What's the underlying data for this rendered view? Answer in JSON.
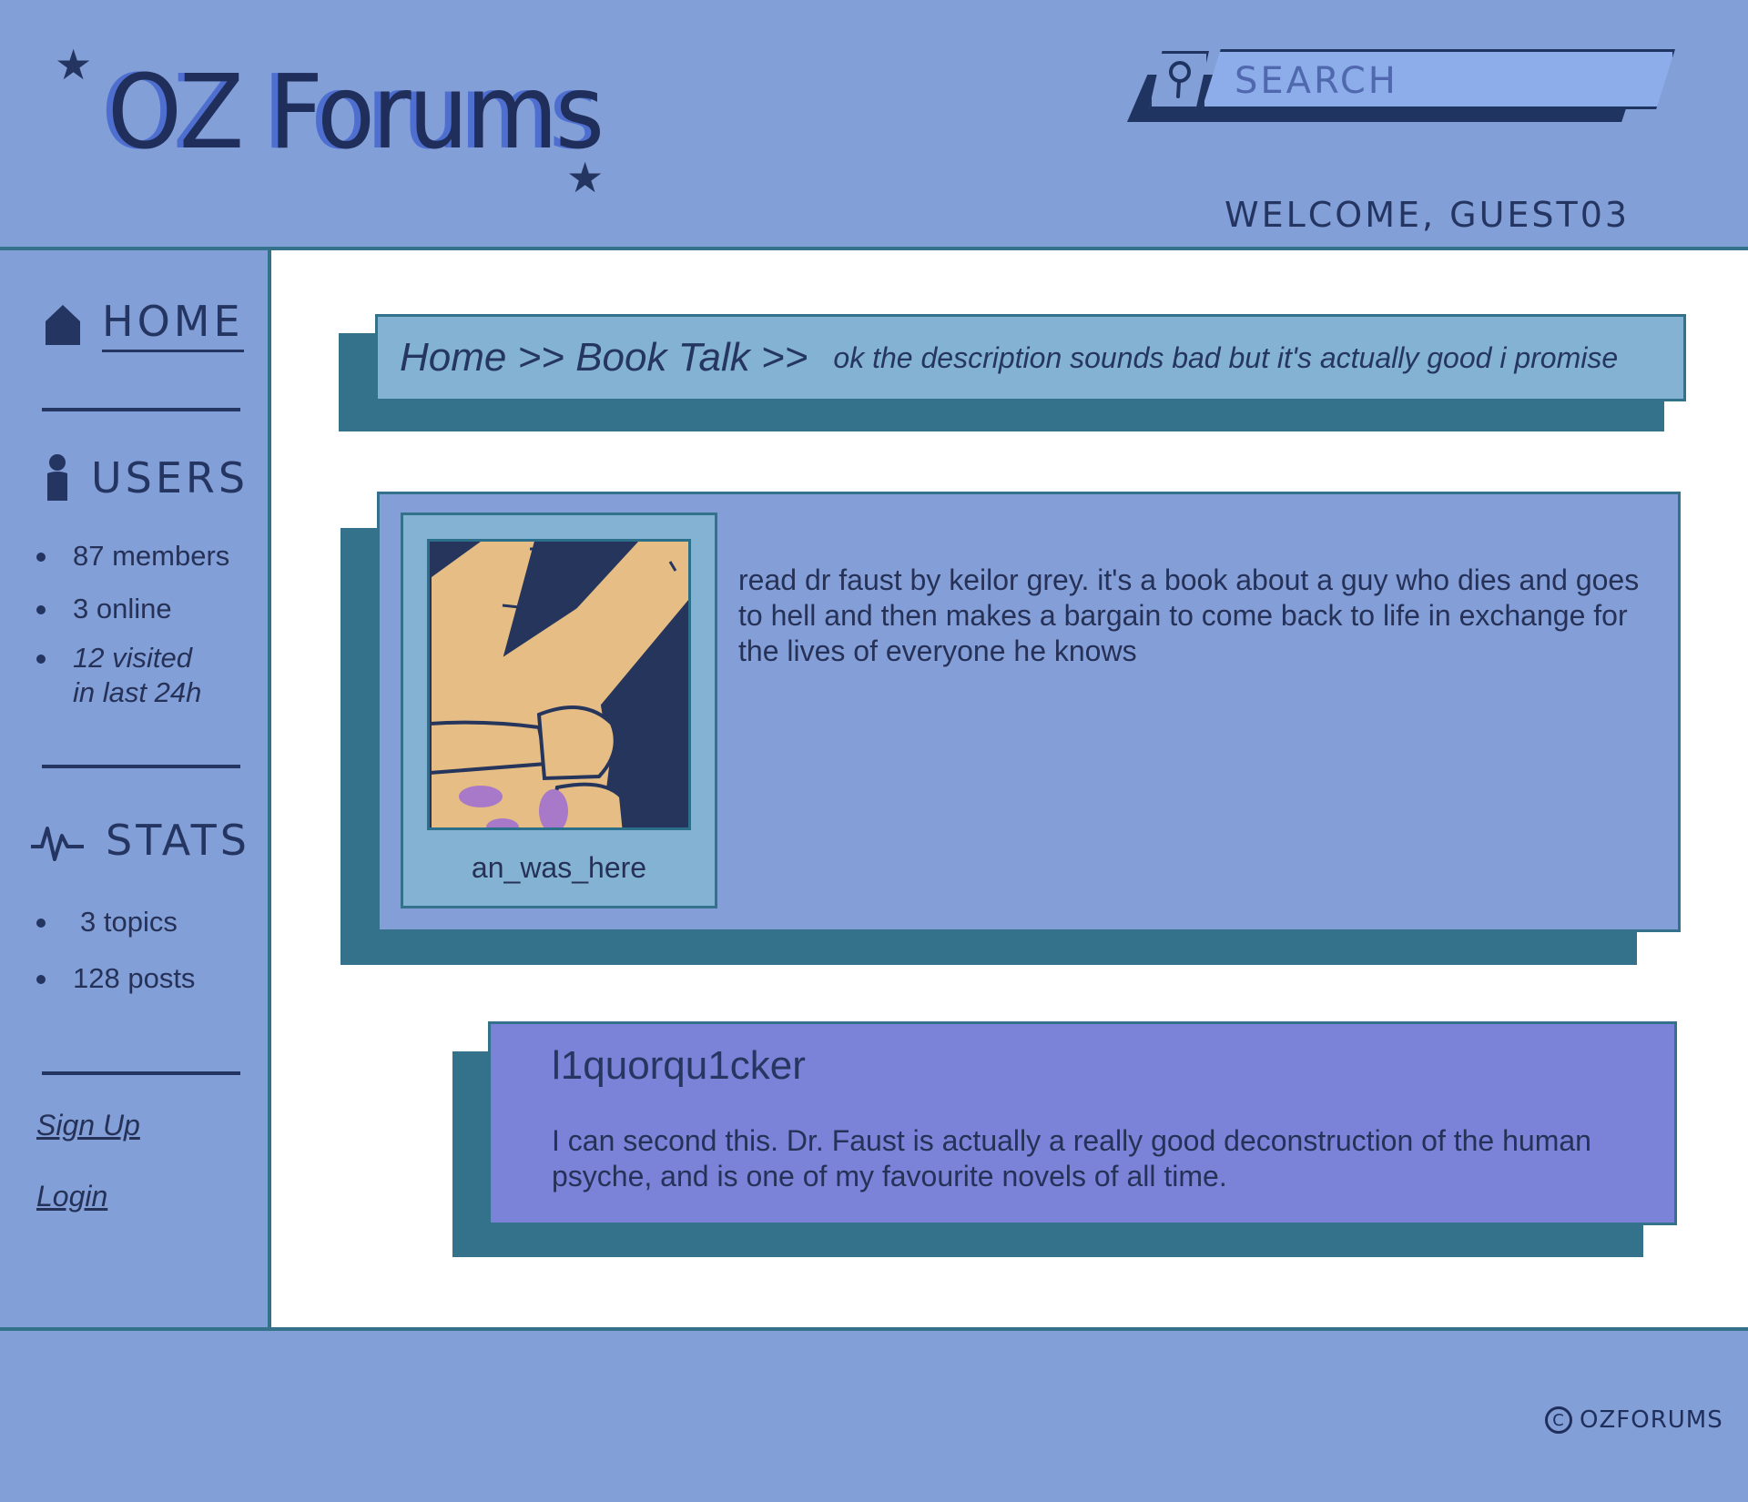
{
  "header": {
    "logo": "OZ Forums",
    "search_placeholder": "SEARCH",
    "welcome": "WELCOME, GUEST03"
  },
  "sidebar": {
    "home_label": "HOME",
    "users_label": "USERS",
    "users_stats": [
      "87 members",
      "3 online",
      "12 visited",
      "in last 24h"
    ],
    "stats_label": "STATS",
    "stats_items": [
      "3 topics",
      "128 posts"
    ],
    "sign_up": "Sign Up",
    "login": "Login"
  },
  "breadcrumb": {
    "path": "Home >> Book Talk >>",
    "thread_title": "ok the description sounds bad but it's actually good i promise"
  },
  "posts": [
    {
      "author": "an_was_here",
      "body": "read dr faust by keilor grey. it's a book about a guy who dies and goes to hell and then makes a bargain to come back to life in exchange for the lives of everyone he knows"
    },
    {
      "author": "l1quorqu1cker",
      "body": "I can second this. Dr. Faust is actually a really good deconstruction of the human psyche, and is one of my favourite novels of all time."
    }
  ],
  "footer": {
    "copyright": "OZFORUMS"
  },
  "colors": {
    "page_bg": "#839fd7",
    "rule": "#34718b",
    "ink": "#243561",
    "breadcrumb_bg": "#84b2d3",
    "post2_bg": "#7b83d8",
    "search_bg": "#8cacea"
  }
}
